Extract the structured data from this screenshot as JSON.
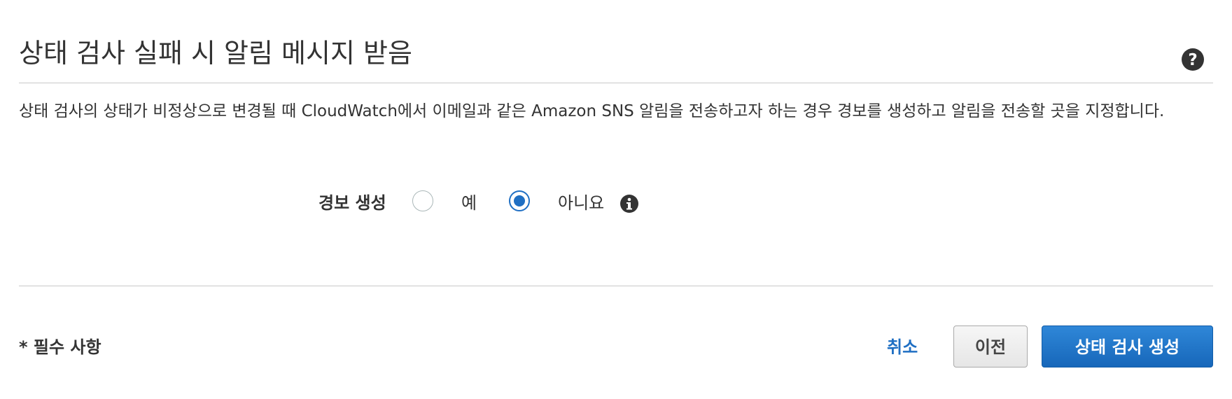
{
  "header": {
    "title": "상태 검사 실패 시 알림 메시지 받음",
    "help_icon": "help-circle-icon"
  },
  "description": "상태 검사의 상태가 비정상으로 변경될 때 CloudWatch에서 이메일과 같은 Amazon SNS 알림을 전송하고자 하는 경우 경보를 생성하고 알림을 전송할 곳을 지정합니다.",
  "alarm": {
    "label": "경보 생성",
    "options": [
      {
        "label": "예",
        "selected": false
      },
      {
        "label": "아니요",
        "selected": true
      }
    ],
    "info_icon": "info-icon"
  },
  "footer": {
    "required_note": "* 필수 사항",
    "cancel_label": "취소",
    "previous_label": "이전",
    "create_label": "상태 검사 생성"
  },
  "colors": {
    "accent": "#1f6fc3",
    "primary_button": "#1f6fc3",
    "text": "#333333",
    "divider": "#c8c8c8"
  }
}
